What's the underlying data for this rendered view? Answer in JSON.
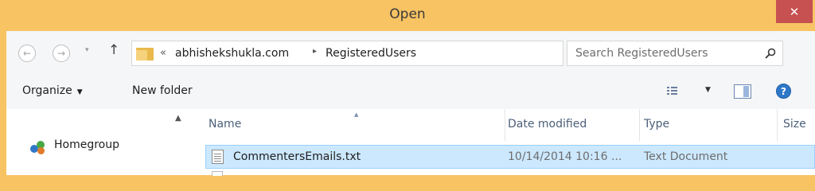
{
  "window": {
    "title": "Open",
    "close_label": "✕"
  },
  "navigation": {
    "back_glyph": "←",
    "forward_glyph": "→",
    "recent_glyph": "▾",
    "up_glyph": "↑"
  },
  "address": {
    "overflow_glyph": "«",
    "crumbs": [
      "abhishekshukla.com",
      "RegisteredUsers"
    ],
    "separator_glyph": "▸",
    "dropdown_glyph": "⌄",
    "refresh_glyph": "↻"
  },
  "search": {
    "placeholder": "Search RegisteredUsers"
  },
  "toolbar": {
    "organize_label": "Organize",
    "organize_caret": "▼",
    "new_folder_label": "New folder",
    "views_caret": "▼",
    "help_label": "?"
  },
  "nav_pane": {
    "scroll_up_glyph": "▲",
    "items": [
      {
        "label": "Homegroup",
        "icon": "homegroup-icon"
      }
    ]
  },
  "file_list": {
    "sort_glyph": "▲",
    "columns": [
      "Name",
      "Date modified",
      "Type",
      "Size"
    ],
    "rows": [
      {
        "name": "CommentersEmails.txt",
        "date_modified": "10/14/2014 10:16 ...",
        "type": "Text Document",
        "icon": "text-file-icon",
        "selected": true
      }
    ]
  },
  "colors": {
    "titlebar": "#f8c363",
    "close_button": "#c75050",
    "selection_fill": "#cce8ff",
    "selection_border": "#99d1ff"
  }
}
